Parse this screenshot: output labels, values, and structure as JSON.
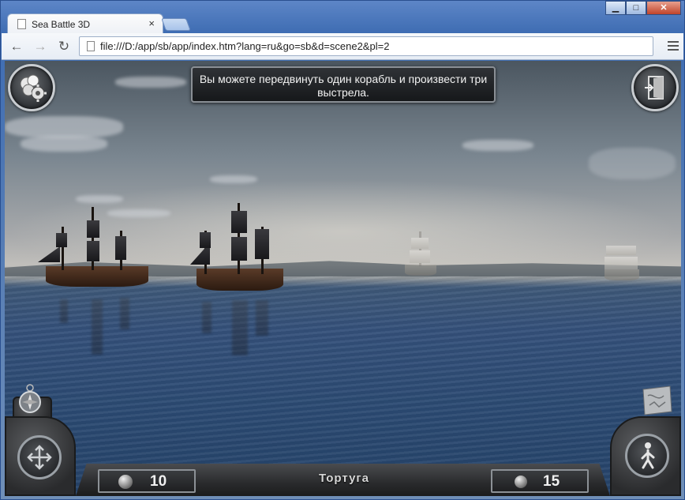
{
  "browser": {
    "tab_title": "Sea Battle 3D",
    "tab_close": "×",
    "url": "file:///D:/app/sb/app/index.htm?lang=ru&go=sb&d=scene2&pl=2",
    "window_buttons": {
      "minimize": "▁",
      "maximize": "□",
      "close": "✕"
    },
    "nav": {
      "back": "←",
      "forward": "→",
      "reload": "↻"
    }
  },
  "game": {
    "message": "Вы можете передвинуть один корабль и произвести три выстрела.",
    "location": "Тортуга",
    "player_shots": "10",
    "enemy_shots": "15",
    "icons": {
      "settings": "gear-icon",
      "exit": "exit-door-icon",
      "compass": "compass-icon",
      "move": "move-arrows-icon",
      "map": "map-scroll-icon",
      "walk": "walking-man-icon",
      "cannonball": "cannonball-icon"
    }
  }
}
